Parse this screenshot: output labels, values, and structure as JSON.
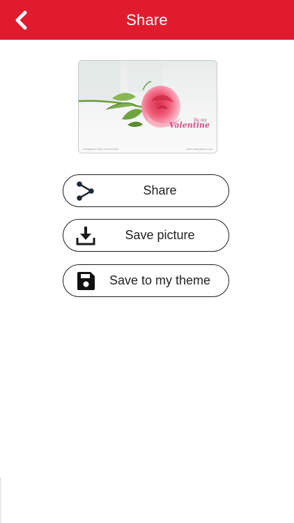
{
  "header": {
    "title": "Share",
    "back_icon": "chevron-left-icon",
    "background_color": "#e01b2e"
  },
  "preview": {
    "tagline": "Be my",
    "title_text": "Valentine",
    "fine_print_left": "Wallpapers May Card Works",
    "fine_print_right": "www.wallpapers.com"
  },
  "actions": [
    {
      "label": "Share",
      "icon": "share-icon"
    },
    {
      "label": "Save picture",
      "icon": "download-icon"
    },
    {
      "label": "Save to my theme",
      "icon": "floppy-disk-icon"
    }
  ]
}
